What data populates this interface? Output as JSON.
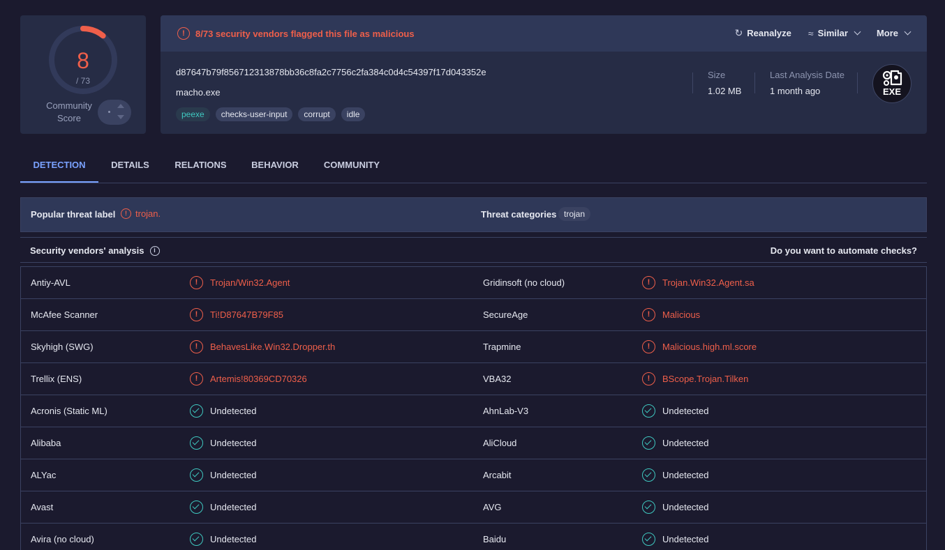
{
  "score": {
    "detections": "8",
    "total": "/ 73",
    "ratio": 0.1096,
    "community_label_line1": "Community",
    "community_label_line2": "Score",
    "community_value": "·",
    "accent_color": "#ef5f4a"
  },
  "file": {
    "alert_text": "8/73 security vendors flagged this file as malicious",
    "actions": {
      "reanalyze": "Reanalyze",
      "similar": "Similar",
      "more": "More"
    },
    "hash": "d87647b79f856712313878bb36c8fa2c7756c2fa384c0d4c54397f17d043352e",
    "name": "macho.exe",
    "tags": [
      "peexe",
      "checks-user-input",
      "corrupt",
      "idle"
    ],
    "size_label": "Size",
    "size_value": "1.02 MB",
    "date_label": "Last Analysis Date",
    "date_value": "1 month ago",
    "type_icon_text": "EXE"
  },
  "tabs": [
    "DETECTION",
    "DETAILS",
    "RELATIONS",
    "BEHAVIOR",
    "COMMUNITY"
  ],
  "threat": {
    "popular_label_title": "Popular threat label",
    "popular_label_value": "trojan.",
    "categories_title": "Threat categories",
    "category": "trojan"
  },
  "vendors_section": {
    "title": "Security vendors' analysis",
    "automate": "Do you want to automate checks?"
  },
  "vendors": [
    {
      "left_name": "Antiy-AVL",
      "left_result": "Trojan/Win32.Agent",
      "left_status": "bad",
      "right_name": "Gridinsoft (no cloud)",
      "right_result": "Trojan.Win32.Agent.sa",
      "right_status": "bad"
    },
    {
      "left_name": "McAfee Scanner",
      "left_result": "Ti!D87647B79F85",
      "left_status": "bad",
      "right_name": "SecureAge",
      "right_result": "Malicious",
      "right_status": "bad"
    },
    {
      "left_name": "Skyhigh (SWG)",
      "left_result": "BehavesLike.Win32.Dropper.th",
      "left_status": "bad",
      "right_name": "Trapmine",
      "right_result": "Malicious.high.ml.score",
      "right_status": "bad"
    },
    {
      "left_name": "Trellix (ENS)",
      "left_result": "Artemis!80369CD70326",
      "left_status": "bad",
      "right_name": "VBA32",
      "right_result": "BScope.Trojan.Tilken",
      "right_status": "bad"
    },
    {
      "left_name": "Acronis (Static ML)",
      "left_result": "Undetected",
      "left_status": "ok",
      "right_name": "AhnLab-V3",
      "right_result": "Undetected",
      "right_status": "ok"
    },
    {
      "left_name": "Alibaba",
      "left_result": "Undetected",
      "left_status": "ok",
      "right_name": "AliCloud",
      "right_result": "Undetected",
      "right_status": "ok"
    },
    {
      "left_name": "ALYac",
      "left_result": "Undetected",
      "left_status": "ok",
      "right_name": "Arcabit",
      "right_result": "Undetected",
      "right_status": "ok"
    },
    {
      "left_name": "Avast",
      "left_result": "Undetected",
      "left_status": "ok",
      "right_name": "AVG",
      "right_result": "Undetected",
      "right_status": "ok"
    },
    {
      "left_name": "Avira (no cloud)",
      "left_result": "Undetected",
      "left_status": "ok",
      "right_name": "Baidu",
      "right_result": "Undetected",
      "right_status": "ok"
    }
  ]
}
